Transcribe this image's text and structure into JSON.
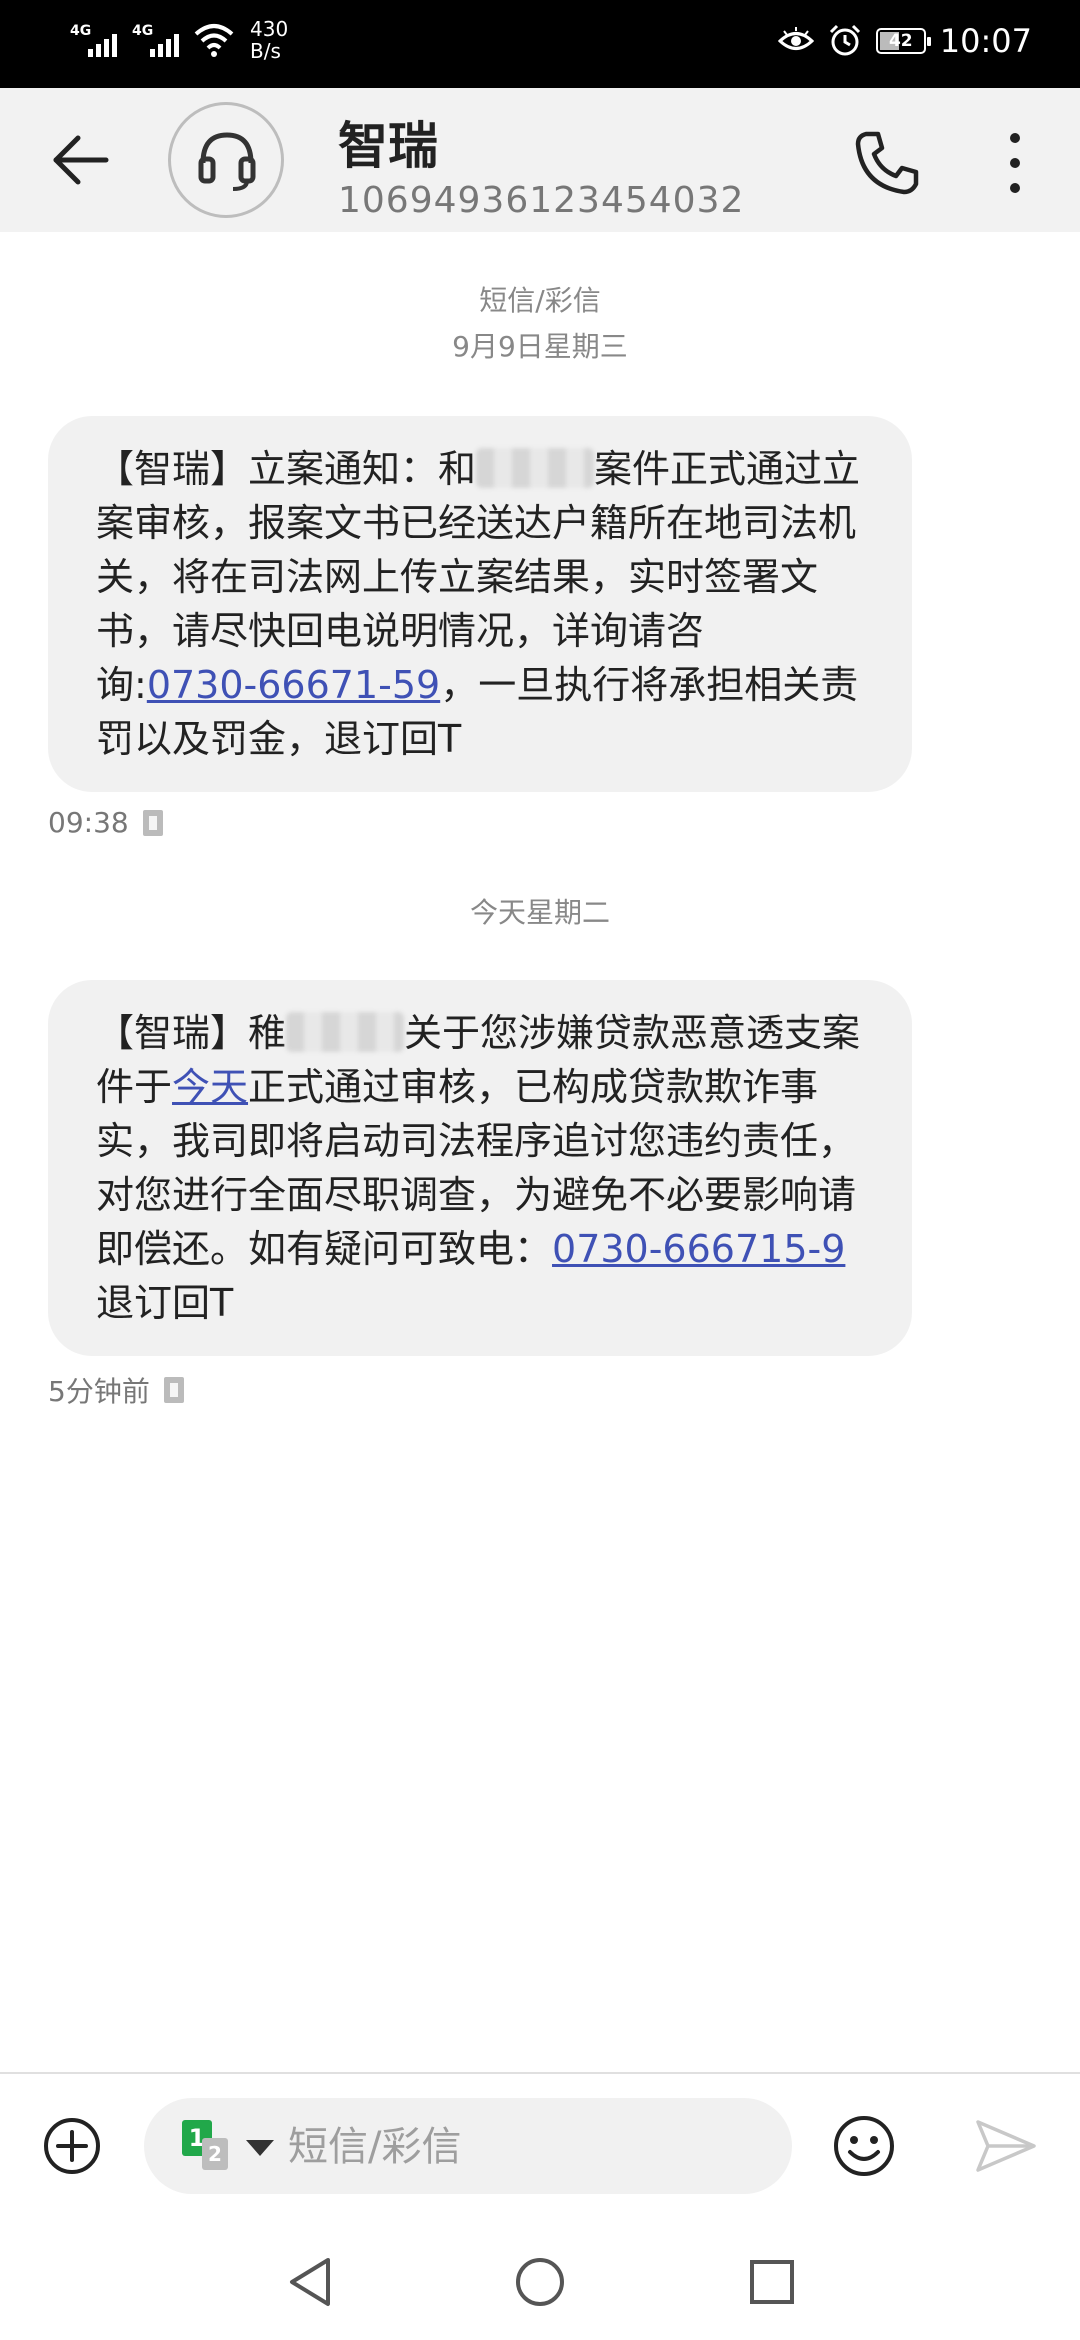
{
  "status_bar": {
    "signal1_tag": "4G",
    "signal2_tag": "4G",
    "net_speed_value": "430",
    "net_speed_unit": "B/s",
    "battery": "42",
    "time": "10:07"
  },
  "header": {
    "contact_name": "智瑞",
    "contact_number": "10694936123454032"
  },
  "conversation": {
    "channel_label": "短信/彩信",
    "date1": "9月9日星期三",
    "message1": {
      "part1": "【智瑞】立案通知：和",
      "part2": "案件正式通过立案审核，报案文书已经送达户籍所在地司法机关，将在司法网上传立案结果，实时签署文书，请尽快回电说明情况，详询请咨询:",
      "link_phone": "0730-66671-59",
      "part3": "，一旦执行将承担相关责罚以及罚金，退订回T",
      "time": "09:38"
    },
    "date2": "今天星期二",
    "message2": {
      "part1": "【智瑞】稚",
      "part2": "关于您涉嫌贷款恶意透支案件于",
      "link_today": "今天",
      "part3": "正式通过审核，已构成贷款欺诈事实，我司即将启动司法程序追讨您违约责任，对您进行全面尽职调查，为避免不必要影响请即偿还。如有疑问可致电：",
      "link_phone": "0730-666715-9",
      "part4": "退订回T",
      "time": "5分钟前"
    }
  },
  "compose": {
    "sim_primary": "1",
    "sim_secondary": "2",
    "placeholder": "短信/彩信"
  },
  "colors": {
    "link": "#3f51b5",
    "bubble": "#f1f1f1",
    "sim1": "#21a84a"
  }
}
